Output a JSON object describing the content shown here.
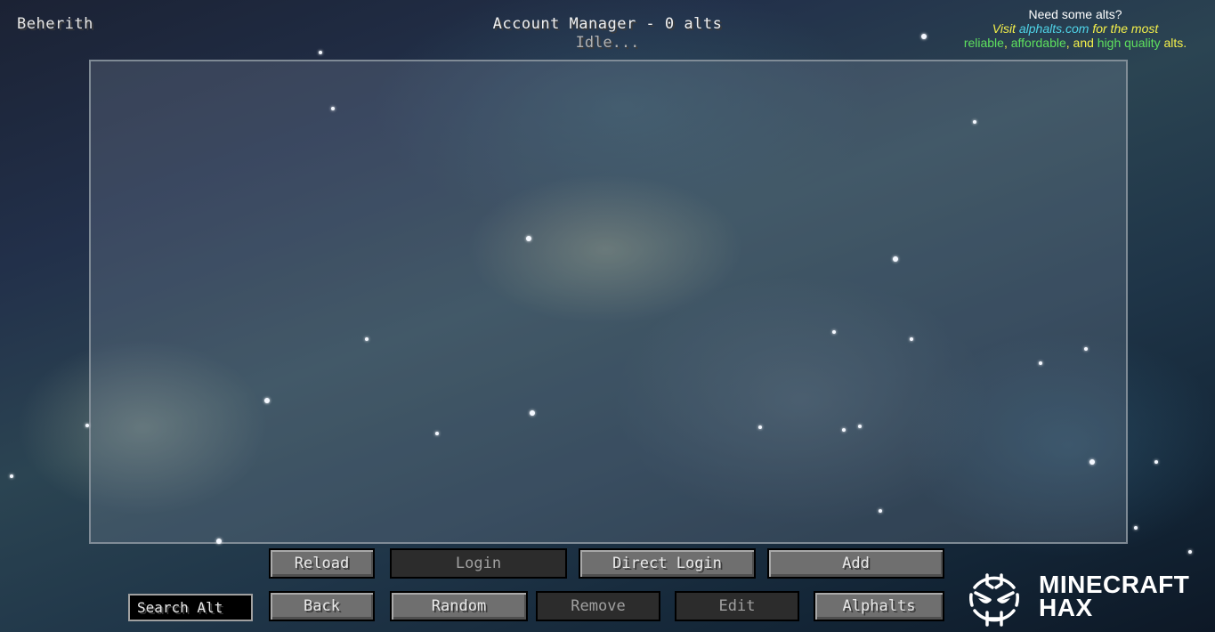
{
  "header": {
    "username": "Beherith",
    "title": "Account Manager - 0 alts",
    "status": "Idle..."
  },
  "promo": {
    "line1": "Need some alts?",
    "line2_prefix": "Visit ",
    "line2_link": "alphalts.com",
    "line2_suffix": " for the most",
    "line3_part1": "reliable",
    "line3_sep1": ", ",
    "line3_part2": "affordable",
    "line3_sep2": ", and ",
    "line3_part3": "high quality",
    "line3_part4": " alts."
  },
  "account_list": {
    "items": []
  },
  "buttons": {
    "reload": {
      "label": "Reload",
      "enabled": true
    },
    "login": {
      "label": "Login",
      "enabled": false
    },
    "direct_login": {
      "label": "Direct Login",
      "enabled": true
    },
    "add": {
      "label": "Add",
      "enabled": true
    },
    "back": {
      "label": "Back",
      "enabled": true
    },
    "random": {
      "label": "Random",
      "enabled": true
    },
    "remove": {
      "label": "Remove",
      "enabled": false
    },
    "edit": {
      "label": "Edit",
      "enabled": false
    },
    "alphalts": {
      "label": "Alphalts",
      "enabled": true
    }
  },
  "search": {
    "placeholder": "Search Alt",
    "value": ""
  },
  "logo": {
    "line1": "MINECRAFT",
    "line2": "HAX"
  },
  "colors": {
    "promo_yellow": "#f4f04a",
    "promo_cyan": "#4fd4e8",
    "promo_green": "#5ee05e",
    "button_enabled": "#6f6f6f",
    "button_disabled": "#2c2c2c"
  }
}
